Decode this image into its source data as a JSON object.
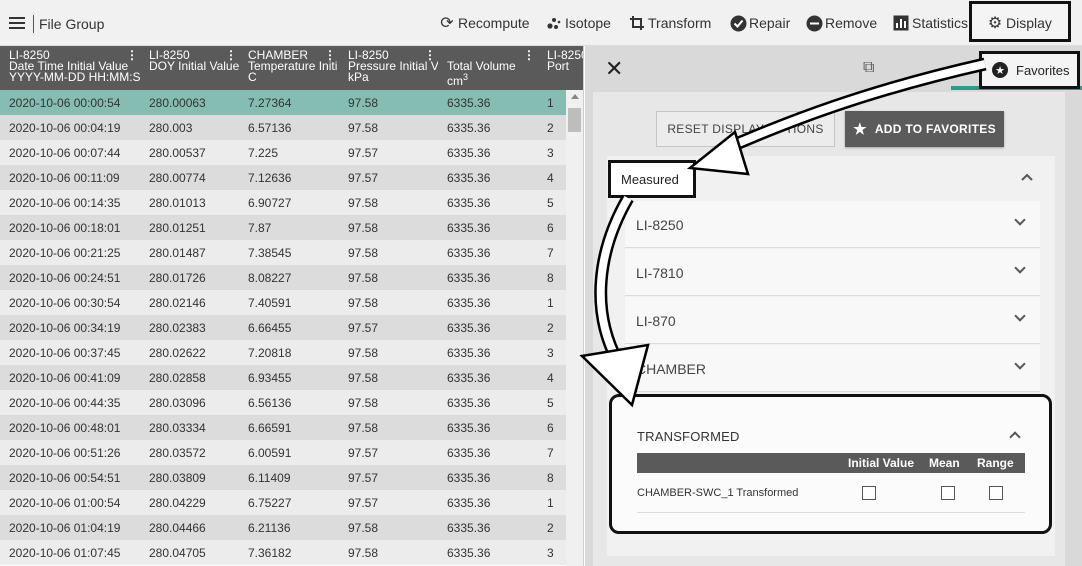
{
  "topbar": {
    "file_group": "File Group",
    "buttons": [
      {
        "label": "Recompute",
        "icon": "recompute-icon"
      },
      {
        "label": "Isotope",
        "icon": "isotope-icon"
      },
      {
        "label": "Transform",
        "icon": "transform-icon"
      },
      {
        "label": "Repair",
        "icon": "repair-icon"
      },
      {
        "label": "Remove",
        "icon": "remove-icon"
      },
      {
        "label": "Statistics",
        "icon": "statistics-icon"
      },
      {
        "label": "Display",
        "icon": "gear-icon"
      }
    ]
  },
  "table": {
    "columns": [
      {
        "l1": "LI-8250",
        "l2": "Date Time Initial Value",
        "l3": "YYYY-MM-DD HH:MM:SS"
      },
      {
        "l1": "LI-8250",
        "l2": "DOY Initial Value",
        "l3": ""
      },
      {
        "l1": "CHAMBER",
        "l2": "Temperature Initi",
        "l3": "C"
      },
      {
        "l1": "LI-8250",
        "l2": "Pressure Initial V",
        "l3": "kPa"
      },
      {
        "l1": "",
        "l2": "Total Volume",
        "l3": "cm3"
      },
      {
        "l1": "LI-8250",
        "l2": "Port",
        "l3": ""
      }
    ],
    "rows": [
      [
        "2020-10-06 00:00:54",
        "280.00063",
        "7.27364",
        "97.58",
        "6335.36",
        "1"
      ],
      [
        "2020-10-06 00:04:19",
        "280.003",
        "6.57136",
        "97.58",
        "6335.36",
        "2"
      ],
      [
        "2020-10-06 00:07:44",
        "280.00537",
        "7.225",
        "97.57",
        "6335.36",
        "3"
      ],
      [
        "2020-10-06 00:11:09",
        "280.00774",
        "7.12636",
        "97.57",
        "6335.36",
        "4"
      ],
      [
        "2020-10-06 00:14:35",
        "280.01013",
        "6.90727",
        "97.58",
        "6335.36",
        "5"
      ],
      [
        "2020-10-06 00:18:01",
        "280.01251",
        "7.87",
        "97.58",
        "6335.36",
        "6"
      ],
      [
        "2020-10-06 00:21:25",
        "280.01487",
        "7.38545",
        "97.58",
        "6335.36",
        "7"
      ],
      [
        "2020-10-06 00:24:51",
        "280.01726",
        "8.08227",
        "97.58",
        "6335.36",
        "8"
      ],
      [
        "2020-10-06 00:30:54",
        "280.02146",
        "7.40591",
        "97.58",
        "6335.36",
        "1"
      ],
      [
        "2020-10-06 00:34:19",
        "280.02383",
        "6.66455",
        "97.57",
        "6335.36",
        "2"
      ],
      [
        "2020-10-06 00:37:45",
        "280.02622",
        "7.20818",
        "97.58",
        "6335.36",
        "3"
      ],
      [
        "2020-10-06 00:41:09",
        "280.02858",
        "6.93455",
        "97.58",
        "6335.36",
        "4"
      ],
      [
        "2020-10-06 00:44:35",
        "280.03096",
        "6.56136",
        "97.58",
        "6335.36",
        "5"
      ],
      [
        "2020-10-06 00:48:01",
        "280.03334",
        "6.66591",
        "97.58",
        "6335.36",
        "6"
      ],
      [
        "2020-10-06 00:51:26",
        "280.03572",
        "6.00591",
        "97.57",
        "6335.36",
        "7"
      ],
      [
        "2020-10-06 00:54:51",
        "280.03809",
        "6.11409",
        "97.57",
        "6335.36",
        "8"
      ],
      [
        "2020-10-06 01:00:54",
        "280.04229",
        "6.75227",
        "97.57",
        "6335.36",
        "1"
      ],
      [
        "2020-10-06 01:04:19",
        "280.04466",
        "6.21136",
        "97.58",
        "6335.36",
        "2"
      ],
      [
        "2020-10-06 01:07:45",
        "280.04705",
        "7.36182",
        "97.58",
        "6335.36",
        "3"
      ]
    ],
    "selected_row": 0
  },
  "panel": {
    "favorites_tab": "Favorites",
    "reset_button": "RESET DISPLAY OPTIONS",
    "add_favorites_button": "ADD TO FAVORITES",
    "measured_label": "Measured",
    "groups": [
      "LI-8250",
      "LI-7810",
      "LI-870",
      "CHAMBER"
    ],
    "transformed": {
      "title": "TRANSFORMED",
      "headers": [
        "Initial Value",
        "Mean",
        "Range"
      ],
      "row_label": "CHAMBER-SWC_1 Transformed"
    }
  },
  "colors": {
    "selected_row": "#86bdb2",
    "header_bg": "#5a5a5a",
    "tab_accent": "#2c9b88"
  }
}
